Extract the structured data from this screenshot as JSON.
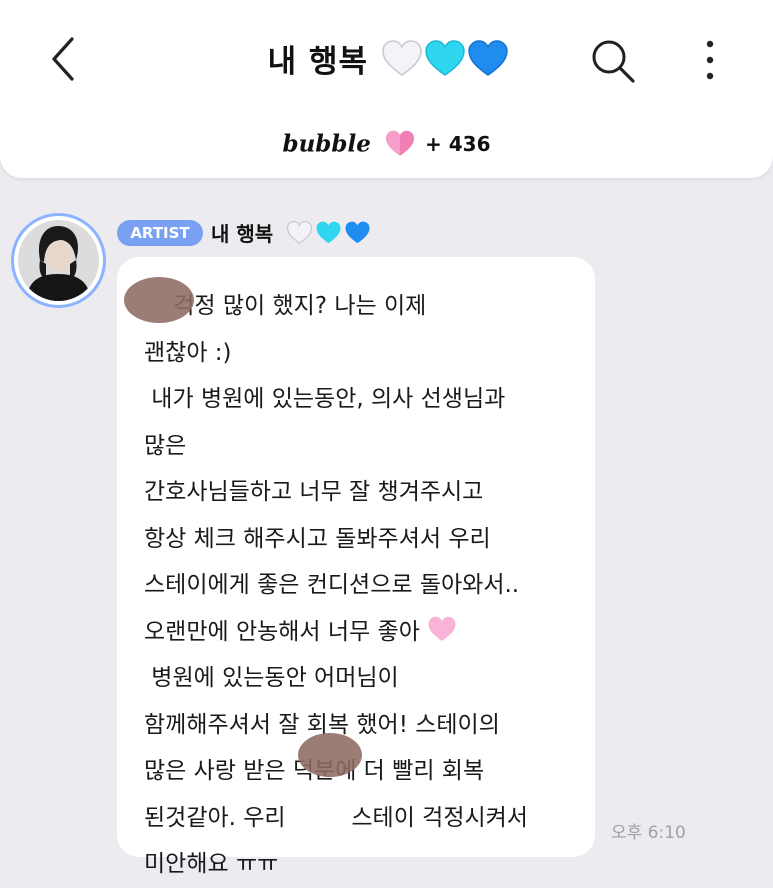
{
  "header": {
    "title": "내 행복",
    "back_icon": "chevron-left-icon",
    "search_icon": "search-icon",
    "more_icon": "more-vertical-icon",
    "title_hearts": [
      "white",
      "cyan",
      "blue"
    ],
    "app_name": "bubble",
    "app_heart_color": "#f07fb8",
    "subscriber_extra": "+ 436"
  },
  "message": {
    "badge": "ARTIST",
    "sender": "내 행복",
    "sender_hearts": [
      "white",
      "cyan",
      "blue"
    ],
    "lines": [
      "    걱정 많이 했지? 나는 이제",
      "괜찮아 :)",
      " 내가 병원에 있는동안, 의사 선생님과",
      "많은",
      "간호사님들하고 너무 잘 챙겨주시고",
      "항상 체크 해주시고 돌봐주셔서 우리",
      "스테이에게 좋은 컨디션으로 돌아와서..",
      "오랜만에 안농해서 너무 좋아",
      " 병원에 있는동안 어머님이",
      "함께해주셔서 잘 회복 했어! 스테이의",
      "많은 사랑 받은 덕분에 더 빨리 회복",
      "된것같아. 우리         스테이 걱정시켜서",
      "미안해요 ㅠㅠ"
    ],
    "time": "오후 6:10"
  },
  "colors": {
    "background": "#ebebf0",
    "badge": "#7aa0f2",
    "avatar_ring": "#8ab4ff",
    "heart_cyan": "#2fd6f0",
    "heart_blue": "#1f8cf0"
  }
}
